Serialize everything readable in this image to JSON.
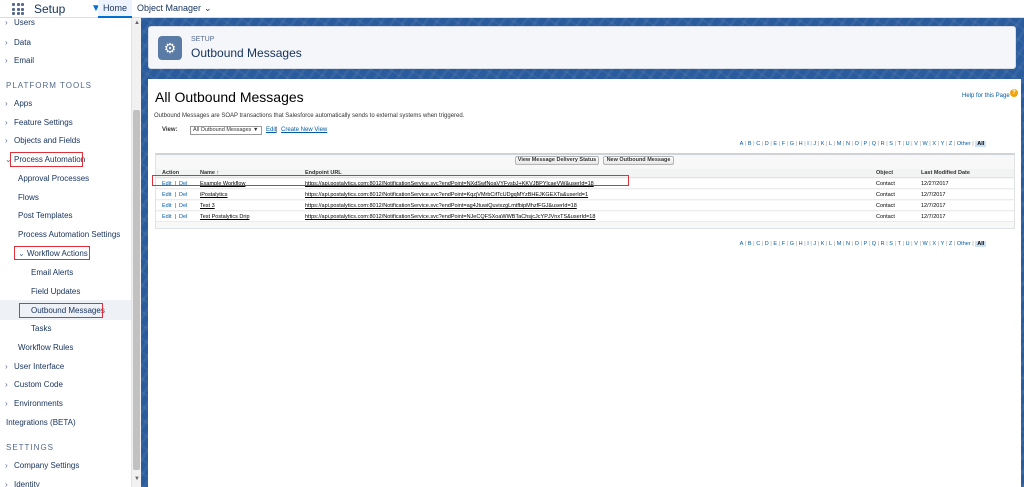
{
  "topbar": {
    "app_name": "Setup",
    "app_menu_icon": "chevron-down-icon",
    "tabs": [
      {
        "label": "Home",
        "active": true
      },
      {
        "label": "Object Manager",
        "active": false
      }
    ]
  },
  "sidebar": {
    "items_top": [
      "Users",
      "Data",
      "Email"
    ],
    "section_platform": "PLATFORM TOOLS",
    "items_platform": [
      "Apps",
      "Feature Settings",
      "Objects and Fields"
    ],
    "process_automation": {
      "label": "Process Automation",
      "children": [
        "Approval Processes",
        "Flows",
        "Post Templates",
        "Process Automation Settings"
      ],
      "workflow_actions": {
        "label": "Workflow Actions",
        "children": [
          "Email Alerts",
          "Field Updates",
          "Outbound Messages",
          "Tasks"
        ],
        "selected": "Outbound Messages"
      },
      "after": [
        "Workflow Rules"
      ]
    },
    "items_after": [
      "User Interface",
      "Custom Code",
      "Environments"
    ],
    "integrations": "Integrations (BETA)",
    "section_settings": "SETTINGS",
    "items_settings": [
      "Company Settings",
      "Identity"
    ]
  },
  "header": {
    "kicker": "SETUP",
    "title": "Outbound Messages",
    "icon": "gear-icon"
  },
  "page": {
    "title": "All Outbound Messages",
    "help_link": "Help for this Page",
    "description": "Outbound Messages are SOAP transactions that Salesforce automatically sends to external systems when triggered.",
    "view_label": "View:",
    "view_selected": "All Outbound Messages",
    "view_edit": "Edit",
    "view_separator": "|",
    "view_create": "Create New View",
    "letters": [
      "A",
      "B",
      "C",
      "D",
      "E",
      "F",
      "G",
      "H",
      "I",
      "J",
      "K",
      "L",
      "M",
      "N",
      "O",
      "P",
      "Q",
      "R",
      "S",
      "T",
      "U",
      "V",
      "W",
      "X",
      "Y",
      "Z",
      "Other",
      "All"
    ],
    "buttons": {
      "delivery": "View Message Delivery Status",
      "new": "New Outbound Message"
    },
    "columns": {
      "action": "Action",
      "name": "Name ↑",
      "endpoint": "Endpoint URL",
      "object": "Object",
      "modified": "Last Modified Date"
    },
    "rows": [
      {
        "edit": "Edit",
        "sep": "|",
        "del": "Del",
        "name": "Example Workflow",
        "endpoint": "https://api.postalytics.com:8012/NotificationService.svc?endPoint=NXdSwfNoaVYFysbJ+KKVJBPYlcaeVW&userId=18",
        "object": "Contact",
        "modified": "12/27/2017"
      },
      {
        "edit": "Edit",
        "sep": "|",
        "del": "Del",
        "name": "iPostalytics",
        "endpoint": "https://api.postalytics.com:8012/NotificationService.svc?endPoint=KqzjVMrbCifTcUDgqMYzBHEJKGEXTa&userId=1",
        "object": "Contact",
        "modified": "12/7/2017"
      },
      {
        "edit": "Edit",
        "sep": "|",
        "del": "Del",
        "name": "Test 3",
        "endpoint": "https://api.postalytics.com:8012/NotificationService.svc?endPoint=ag4JtuwiQuvixzgLmtfbipMhzfFGJ&userId=18",
        "object": "Contact",
        "modified": "12/7/2017"
      },
      {
        "edit": "Edit",
        "sep": "|",
        "del": "Del",
        "name": "Test Postalytics Drip",
        "endpoint": "https://api.postalytics.com:8012/NotificationService.svc?endPoint=NJeCQFSXoaWWBTaChsjcJcYPJVnxTS&userId=18",
        "object": "Contact",
        "modified": "12/7/2017"
      }
    ]
  },
  "highlight_color": "#e0303a",
  "accent_color": "#0070d2"
}
